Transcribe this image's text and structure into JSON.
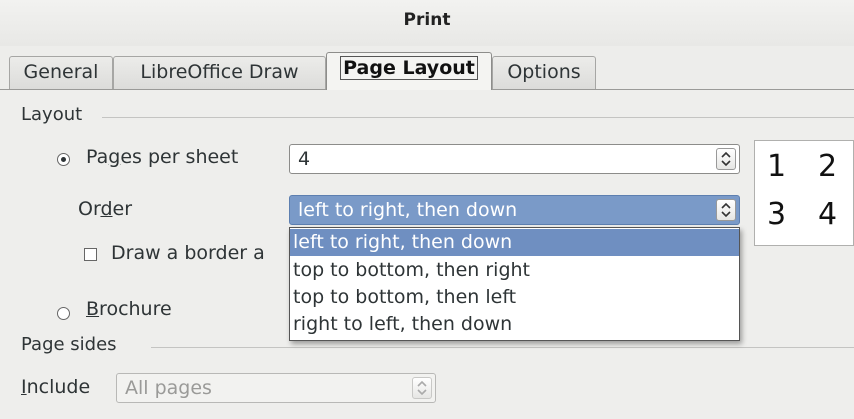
{
  "window": {
    "title": "Print"
  },
  "tabs": [
    {
      "label": "General",
      "active": false
    },
    {
      "label": "LibreOffice Draw",
      "active": false
    },
    {
      "label": "Page Layout",
      "active": true
    },
    {
      "label": "Options",
      "active": false
    }
  ],
  "layout": {
    "section_label": "Layout",
    "pages_per_sheet": {
      "label_pre": "Pa",
      "label_accel": "g",
      "label_post": "es per sheet",
      "checked": true,
      "value": "4"
    },
    "order": {
      "label_pre": "Or",
      "label_accel": "d",
      "label_post": "er",
      "value": "left to right, then down"
    },
    "draw_border": {
      "label": "Draw a border a",
      "checked": false
    },
    "brochure": {
      "label_accel": "B",
      "label_post": "rochure",
      "checked": false
    },
    "preview_numbers": [
      "1",
      "2",
      "3",
      "4"
    ]
  },
  "order_dropdown": {
    "options": [
      "left to right, then down",
      "top to bottom, then right",
      "top to bottom, then left",
      "right to left, then down"
    ],
    "highlighted_index": 0
  },
  "page_sides": {
    "section_label": "Page sides",
    "include": {
      "label_accel": "I",
      "label_post": "nclude",
      "value": "All pages",
      "disabled": true
    }
  },
  "colors": {
    "selection": "#6f8fc1",
    "background": "#eeeeec"
  }
}
